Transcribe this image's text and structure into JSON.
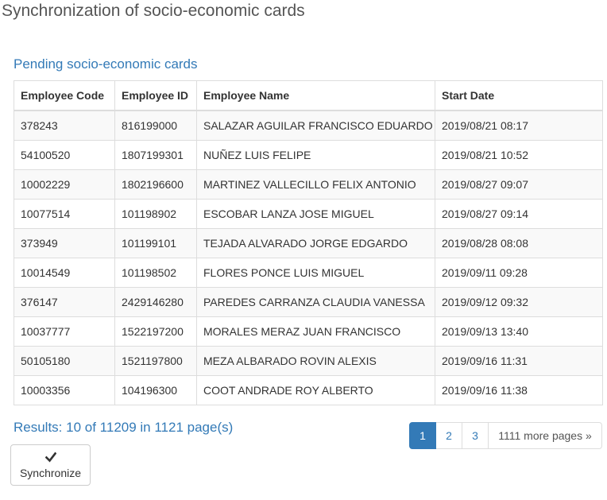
{
  "page": {
    "title": "Synchronization of socio-economic cards"
  },
  "section": {
    "title": "Pending socio-economic cards"
  },
  "table": {
    "columns": [
      "Employee Code",
      "Employee ID",
      "Employee Name",
      "Start Date"
    ],
    "rows": [
      [
        "378243",
        "816199000",
        "SALAZAR AGUILAR FRANCISCO EDUARDO",
        "2019/08/21 08:17"
      ],
      [
        "54100520",
        "1807199301",
        "NUÑEZ LUIS FELIPE",
        "2019/08/21 10:52"
      ],
      [
        "10002229",
        "1802196600",
        "MARTINEZ VALLECILLO FELIX ANTONIO",
        "2019/08/27 09:07"
      ],
      [
        "10077514",
        "101198902",
        "ESCOBAR LANZA JOSE MIGUEL",
        "2019/08/27 09:14"
      ],
      [
        "373949",
        "101199101",
        "TEJADA ALVARADO JORGE EDGARDO",
        "2019/08/28 08:08"
      ],
      [
        "10014549",
        "101198502",
        "FLORES PONCE LUIS MIGUEL",
        "2019/09/11 09:28"
      ],
      [
        "376147",
        "2429146280",
        "PAREDES CARRANZA CLAUDIA VANESSA",
        "2019/09/12 09:32"
      ],
      [
        "10037777",
        "1522197200",
        "MORALES MERAZ JUAN FRANCISCO",
        "2019/09/13 13:40"
      ],
      [
        "50105180",
        "1521197800",
        "MEZA ALBARADO ROVIN ALEXIS",
        "2019/09/16 11:31"
      ],
      [
        "10003356",
        "104196300",
        "COOT ANDRADE ROY ALBERTO",
        "2019/09/16 11:38"
      ]
    ]
  },
  "results": {
    "text": "Results: 10 of 11209 in 1121 page(s)"
  },
  "pagination": {
    "pages": [
      "1",
      "2",
      "3"
    ],
    "active_page": "1",
    "more_label": "1111 more pages »"
  },
  "actions": {
    "sync_label": "Synchronize",
    "sync_icon": "checkmark-icon"
  },
  "colors": {
    "accent": "#337ab7",
    "title_gray": "#555555",
    "border": "#dddddd",
    "stripe": "#f9f9f9"
  }
}
